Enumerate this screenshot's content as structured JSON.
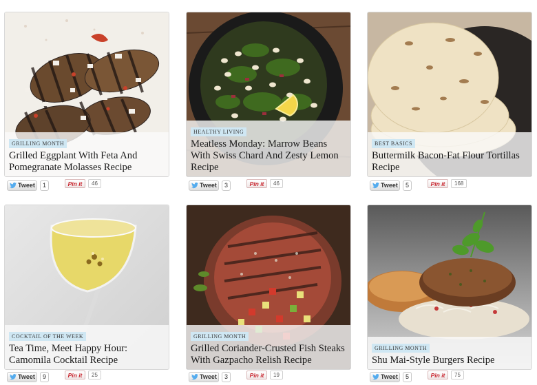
{
  "cards": [
    {
      "category": "GRILLING MONTH",
      "title": "Grilled Eggplant With Feta And Pomegranate Molasses Recipe",
      "tweet_label": "Tweet",
      "tweet_count": "1",
      "pin_label": "Pin it",
      "pin_count": "46"
    },
    {
      "category": "HEALTHY LIVING",
      "title": "Meatless Monday: Marrow Beans With Swiss Chard And Zesty Lemon Recipe",
      "tweet_label": "Tweet",
      "tweet_count": "3",
      "pin_label": "Pin it",
      "pin_count": "46"
    },
    {
      "category": "BEST BASICS",
      "title": "Buttermilk Bacon-Fat Flour Tortillas Recipe",
      "tweet_label": "Tweet",
      "tweet_count": "5",
      "pin_label": "Pin it",
      "pin_count": "168"
    },
    {
      "category": "COCKTAIL OF THE WEEK",
      "title": "Tea Time, Meet Happy Hour: Camomila Cocktail Recipe",
      "tweet_label": "Tweet",
      "tweet_count": "9",
      "pin_label": "Pin it",
      "pin_count": "25"
    },
    {
      "category": "GRILLING MONTH",
      "title": "Grilled Coriander-Crusted Fish Steaks With Gazpacho Relish Recipe",
      "tweet_label": "Tweet",
      "tweet_count": "3",
      "pin_label": "Pin it",
      "pin_count": "19"
    },
    {
      "category": "GRILLING MONTH",
      "title": "Shu Mai-Style Burgers Recipe",
      "tweet_label": "Tweet",
      "tweet_count": "5",
      "pin_label": "Pin it",
      "pin_count": "75"
    }
  ],
  "colors": {
    "tag_bg": "#cfe7f3",
    "pin_red": "#c8232c",
    "twitter_blue": "#55acee"
  },
  "icons": {
    "tweet": "twitter-bird-icon"
  }
}
